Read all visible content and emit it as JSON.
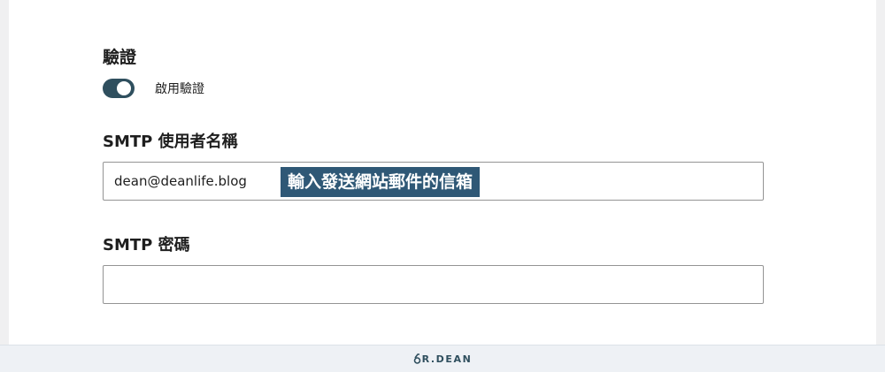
{
  "auth_section": {
    "title": "驗證",
    "toggle_label": "啟用驗證",
    "toggle_on": true
  },
  "smtp_username": {
    "label": "SMTP 使用者名稱",
    "value": "dean@deanlife.blog"
  },
  "annotation": {
    "text": "輸入發送網站郵件的信箱"
  },
  "smtp_password": {
    "label": "SMTP 密碼",
    "value": ""
  },
  "footer": {
    "brand": "R.DEAN"
  },
  "colors": {
    "toggle_on": "#2f4f5e",
    "annotation_bg": "#2f5876"
  }
}
